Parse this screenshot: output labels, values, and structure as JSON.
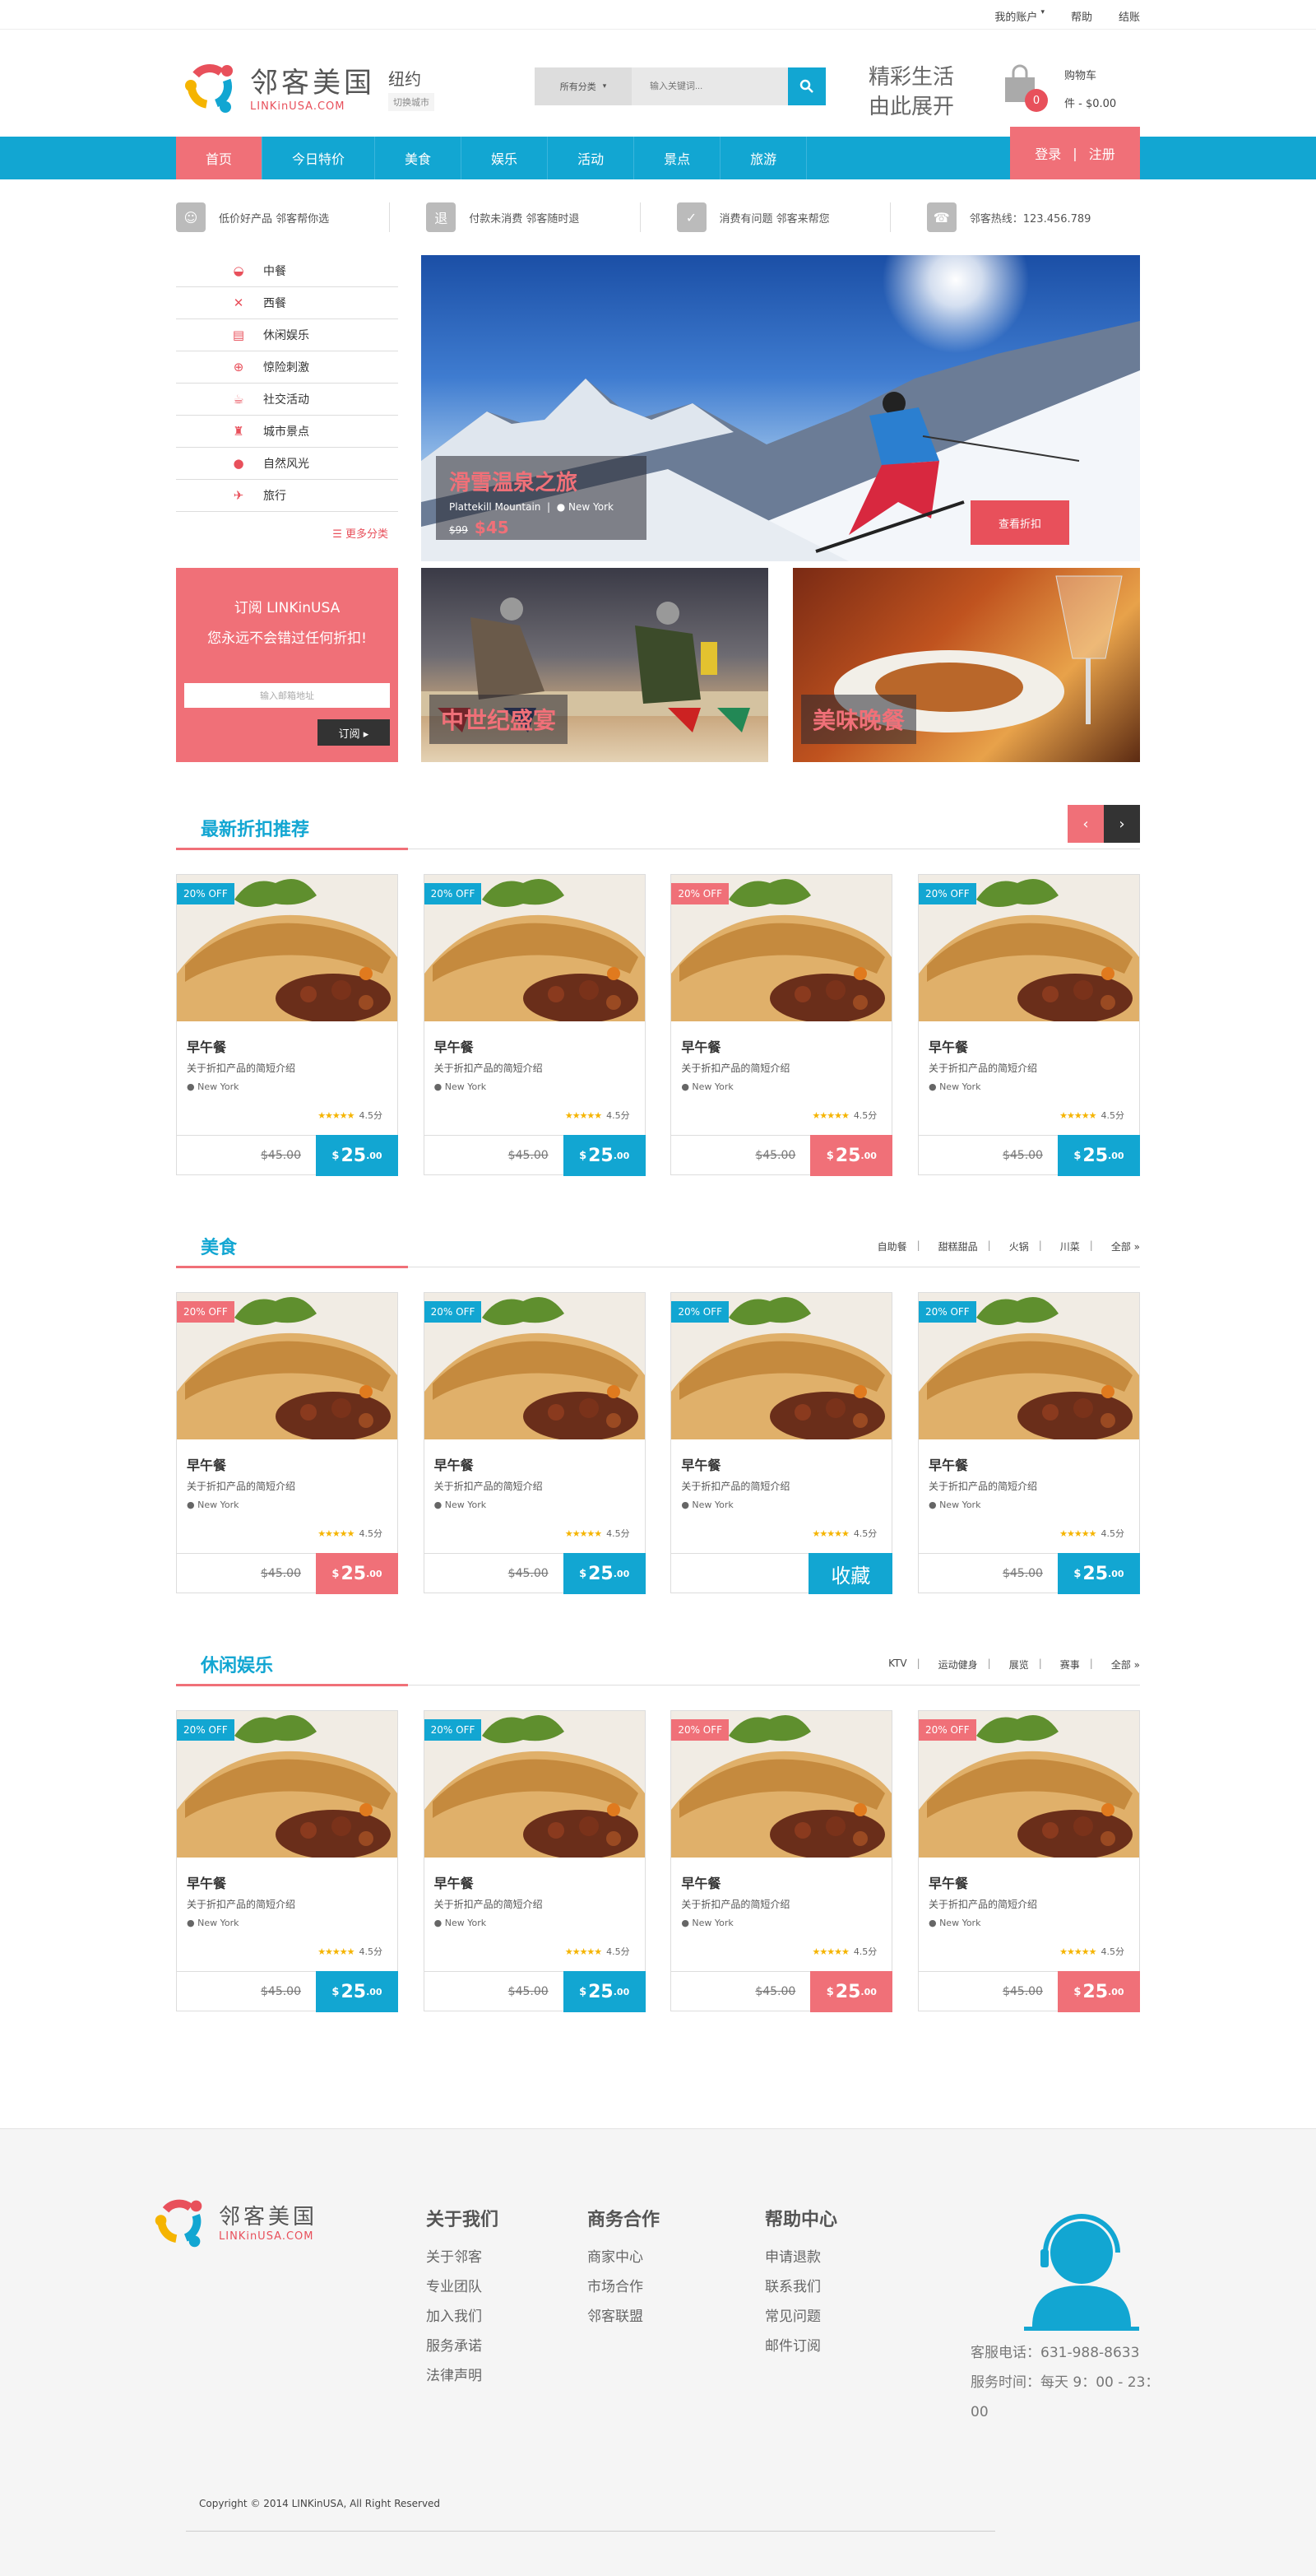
{
  "topbar": {
    "account": "我的账户",
    "help": "帮助",
    "checkout": "结账"
  },
  "logo": {
    "cn": "邻客美国",
    "en": "LINKinUSA.COM"
  },
  "city": {
    "name": "纽约",
    "switch": "切换城市"
  },
  "search": {
    "category": "所有分类",
    "placeholder": "输入关键词..."
  },
  "slogan": {
    "line1": "精彩生活",
    "line2": "由此展开"
  },
  "cart": {
    "label": "购物车",
    "count": "0",
    "summary": "件 - $0.00"
  },
  "nav": {
    "items": [
      "首页",
      "今日特价",
      "美食",
      "娱乐",
      "活动",
      "景点",
      "旅游"
    ],
    "login": "登录",
    "register": "注册"
  },
  "features": [
    "低价好产品 邻客帮你选",
    "付款未消费 邻客随时退",
    "消费有问题 邻客来帮您",
    "邻客热线：123.456.789"
  ],
  "sidebar": {
    "items": [
      "中餐",
      "西餐",
      "休闲娱乐",
      "惊险刺激",
      "社交活动",
      "城市景点",
      "自然风光",
      "旅行"
    ],
    "more": "更多分类"
  },
  "banner": {
    "title": "滑雪温泉之旅",
    "sub": "Plattekill Mountain",
    "loc": "New York",
    "old_price": "$99",
    "new_price": "$45",
    "button": "查看折扣"
  },
  "subscribe": {
    "title": "订阅 LINKinUSA",
    "desc": "您永远不会错过任何折扣!",
    "placeholder": "输入邮箱地址",
    "button": "订阅 ▸"
  },
  "tiles": [
    "中世纪盛宴",
    "美味晚餐"
  ],
  "sections": [
    {
      "title": "最新折扣推荐",
      "tags": []
    },
    {
      "title": "美食",
      "tags": [
        "自助餐",
        "|",
        "甜糕甜品",
        "|",
        "火锅",
        "|",
        "川菜",
        "|",
        "全部 »"
      ]
    },
    {
      "title": "休闲娱乐",
      "tags": [
        "KTV",
        "|",
        "运动健身",
        "|",
        "展览",
        "|",
        "赛事",
        "|",
        "全部 »"
      ]
    }
  ],
  "card": {
    "name": "早午餐",
    "desc": "关于折扣产品的简短介绍",
    "loc": "New York",
    "rating": "4.5分",
    "old": "$45.00",
    "price": "25",
    "cents": "00",
    "collect": "收藏"
  },
  "offs": [
    [
      "20% OFF",
      "20% OFF",
      "20% OFF",
      "20% OFF"
    ],
    [
      "20% OFF",
      "20% OFF",
      "20% OFF",
      "20% OFF"
    ],
    [
      "20% OFF",
      "20% OFF",
      "20% OFF",
      "20% OFF"
    ]
  ],
  "footer": {
    "cols": [
      {
        "h": "关于我们",
        "items": [
          "关于邻客",
          "专业团队",
          "加入我们",
          "服务承诺",
          "法律声明"
        ]
      },
      {
        "h": "商务合作",
        "items": [
          "商家中心",
          "市场合作",
          "邻客联盟"
        ]
      },
      {
        "h": "帮助中心",
        "items": [
          "申请退款",
          "联系我们",
          "常见问题",
          "邮件订阅"
        ]
      }
    ],
    "phone": "客服电话：631-988-8633",
    "hours": "服务时间：每天 9：00 - 23：00",
    "copyright": "Copyright © 2014 LINKinUSA,  All Right Reserved"
  },
  "colors": {
    "accent": "#12a6d2",
    "brand": "#f07078"
  }
}
